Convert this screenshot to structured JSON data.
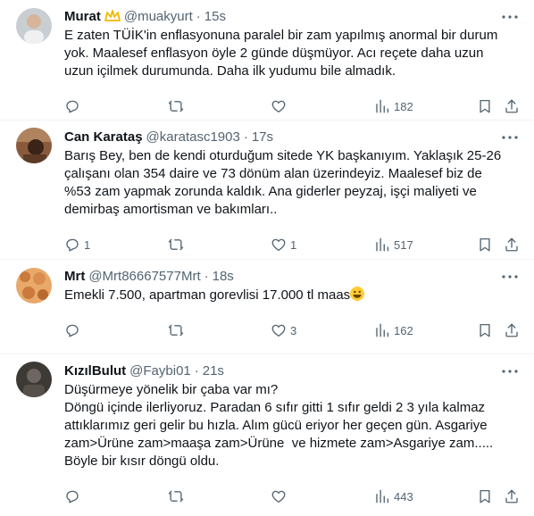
{
  "tweets": [
    {
      "name": "Murat",
      "handle": "@muakyurt",
      "sep": "·",
      "time": "15s",
      "badge": "crown-badge",
      "text": "E zaten TÜİK'in enflasyonuna paralel bir zam yapılmış anormal bir durum yok. Maalesef enflasyon öyle 2 günde düşmüyor. Acı reçete daha uzun uzun içilmek durumunda. Daha ilk yudumu bile almadık.",
      "replies": "",
      "retweets": "",
      "likes": "",
      "views": "182"
    },
    {
      "name": "Can Karataş",
      "handle": "@karatasc1903",
      "sep": "·",
      "time": "17s",
      "text": "Barış Bey, ben de kendi oturduğum sitede YK başkanıyım. Yaklaşık 25-26 çalışanı olan 354 daire ve 73 dönüm alan üzerindeyiz. Maalesef biz de %53 zam yapmak zorunda kaldık. Ana giderler peyzaj, işçi maliyeti ve demirbaş amortisman ve bakımları..",
      "replies": "1",
      "retweets": "",
      "likes": "1",
      "views": "517"
    },
    {
      "name": "Mrt",
      "handle": "@Mrt86667577Mrt",
      "sep": "·",
      "time": "18s",
      "text": "Emekli 7.500, apartman gorevlisi 17.000 tl maas",
      "emoji": "grinning-face-emoji",
      "replies": "",
      "retweets": "",
      "likes": "3",
      "views": "162"
    },
    {
      "name": "KızılBulut",
      "handle": "@Faybi01",
      "sep": "·",
      "time": "21s",
      "text": "Düşürmeye yönelik bir çaba var mı?\nDöngü içinde ilerliyoruz. Paradan 6 sıfır gitti 1 sıfır geldi 2 3 yıla kalmaz attıklarımız geri gelir bu hızla. Alım gücü eriyor her geçen gün. Asgariye zam>Ürüne zam>maaşa zam>Ürüne  ve hizmete zam>Asgariye zam.....\nBöyle bir kısır döngü oldu.",
      "replies": "",
      "retweets": "",
      "likes": "",
      "views": "443"
    }
  ],
  "icons": {
    "reply": "reply-icon",
    "retweet": "retweet-icon",
    "like": "like-icon",
    "views": "views-icon",
    "bookmark": "bookmark-icon",
    "share": "share-icon",
    "more": "more-icon"
  },
  "colors": {
    "text": "#0f1419",
    "secondary": "#536471",
    "divider": "#eff3f4",
    "badge": "#f5b800"
  }
}
